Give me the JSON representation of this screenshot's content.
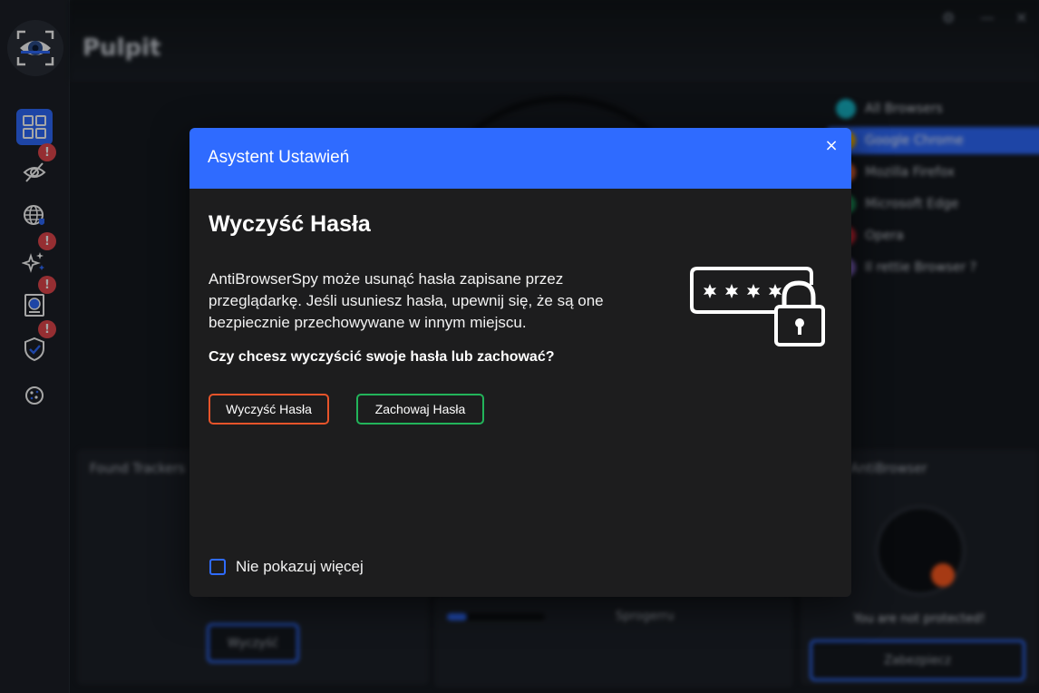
{
  "sidebar": {
    "logo": "eye-scan-logo",
    "items": [
      {
        "icon": "dashboard-grid-icon",
        "active": true,
        "badge": ""
      },
      {
        "icon": "eye-privacy-icon",
        "active": false,
        "badge": "!"
      },
      {
        "icon": "globe-shield-icon",
        "active": false,
        "badge": ""
      },
      {
        "icon": "sparkle-icon",
        "active": false,
        "badge": "!"
      },
      {
        "icon": "device-scan-icon",
        "active": false,
        "badge": "!"
      },
      {
        "icon": "shield-check-icon",
        "active": false,
        "badge": "!"
      },
      {
        "icon": "cookie-icon",
        "active": false,
        "badge": ""
      }
    ]
  },
  "background": {
    "page_title": "Pulpit",
    "browsers": [
      {
        "label": "All Browsers",
        "color": "#17b6c8"
      },
      {
        "label": "Google Chrome",
        "color": "#f3b400",
        "selected": true
      },
      {
        "label": "Mozilla Firefox",
        "color": "#ff7139"
      },
      {
        "label": "Microsoft Edge",
        "color": "#1fa463"
      },
      {
        "label": "Opera",
        "color": "#e0283a"
      },
      {
        "label": "Il  rettie Browser ?",
        "color": "#8a6bd1"
      }
    ],
    "card_left_title": "Found Trackers",
    "card_left_button": "Wyczyść",
    "card_mid_label": "Sprogerru",
    "card_right_title": "AntiBrowser",
    "card_right_status": "You are not protected!",
    "card_right_button": "Zabezpiecz"
  },
  "modal": {
    "title": "Asystent Ustawień",
    "close_label": "×",
    "heading": "Wyczyść Hasła",
    "description": "AntiBrowserSpy może usunąć hasła zapisane przez przeglądarkę. Jeśli usuniesz hasła, upewnij się, że są one bezpiecznie przechowywane w innym miejscu.",
    "question": "Czy chcesz wyczyścić swoje hasła lub zachować?",
    "clear_button": "Wyczyść Hasła",
    "keep_button": "Zachowaj Hasła",
    "dont_show_label": "Nie pokazuj więcej",
    "dont_show_checked": false,
    "illustration": "password-lock-icon",
    "colors": {
      "accent": "#2f6bff",
      "clear": "#e8542a",
      "keep": "#22b45a"
    }
  }
}
